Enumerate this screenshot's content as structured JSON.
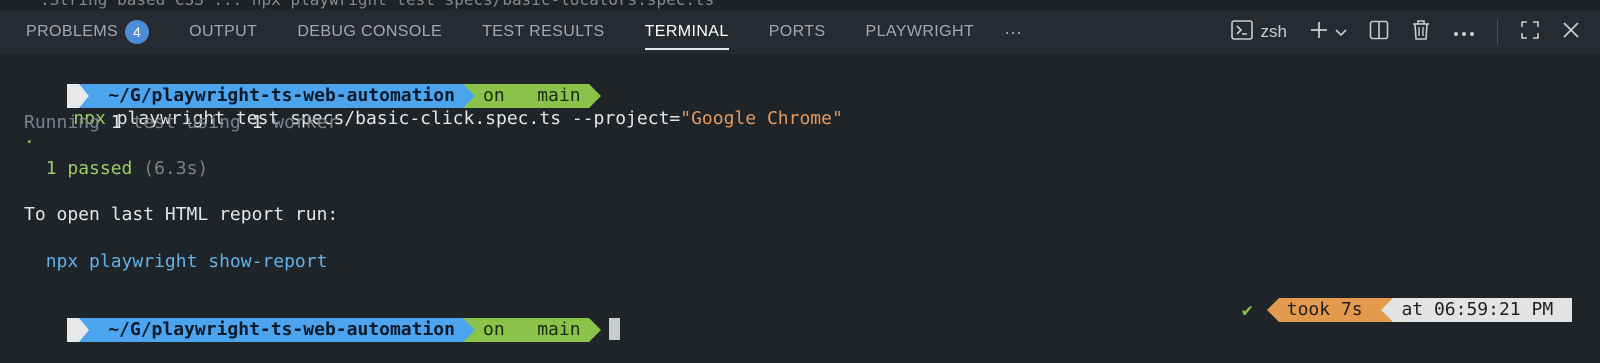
{
  "header": {
    "tabs": [
      {
        "label": "PROBLEMS",
        "badge": "4"
      },
      {
        "label": "OUTPUT"
      },
      {
        "label": "DEBUG CONSOLE"
      },
      {
        "label": "TEST RESULTS"
      },
      {
        "label": "TERMINAL",
        "active": true
      },
      {
        "label": "PORTS"
      },
      {
        "label": "PLAYWRIGHT"
      }
    ],
    "more": "···",
    "shell_name": "zsh",
    "icons": [
      "terminal-icon",
      "plus-icon",
      "chevron-down-icon",
      "split-icon",
      "trash-icon",
      "ellipsis-icon",
      "maximize-icon",
      "close-icon"
    ]
  },
  "terminal": {
    "prompt1": {
      "os": "",
      "folder_icon": "",
      "path": "~/G/playwright-ts-web-automation",
      "git_prefix": "on",
      "git_icons": " ",
      "branch": "main",
      "cmd": "npx",
      "args": "playwright test specs/basic-click.spec.ts --project=",
      "str": "\"Google Chrome\""
    },
    "out1_a": "Running ",
    "out1_b": "1",
    "out1_c": " test using ",
    "out1_d": "1",
    "out1_e": " worker",
    "dot": "·",
    "passed": "1 passed",
    "duration": "(6.3s)",
    "report_msg": "To open last HTML report run:",
    "report_cmd": "npx playwright show-report",
    "prompt2": {
      "os": "",
      "folder_icon": "",
      "path": "~/G/playwright-ts-web-automation",
      "git_prefix": "on",
      "git_icons": " ",
      "branch": "main"
    },
    "right": {
      "check": "✔",
      "took": "took 7s",
      "took_icon": "",
      "at": "at 06:59:21 PM",
      "clock_icon": ""
    }
  },
  "colors": {
    "path_bg": "#4ca3ee",
    "git_bg": "#8bc34a",
    "took_bg": "#e3994e"
  }
}
